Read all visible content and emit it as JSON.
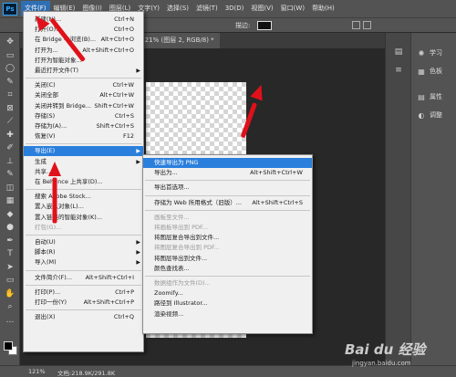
{
  "menubar": {
    "items": [
      "文件(F)",
      "编辑(E)",
      "图像(I)",
      "图层(L)",
      "文字(Y)",
      "选择(S)",
      "滤镜(T)",
      "3D(D)",
      "视图(V)",
      "窗口(W)",
      "帮助(H)"
    ],
    "logo": "Ps"
  },
  "optbar": {
    "label": "描边:"
  },
  "tab": {
    "title": "@ 121% (图层 2, RGB/8) *"
  },
  "status": {
    "zoom": "121%",
    "doc": "文档:218.9K/291.8K"
  },
  "file_menu": [
    {
      "label": "新建(N)...",
      "key": "Ctrl+N"
    },
    {
      "label": "打开(O)...",
      "key": "Ctrl+O"
    },
    {
      "label": "在 Bridge 中浏览(B)...",
      "key": "Alt+Ctrl+O"
    },
    {
      "label": "打开为...",
      "key": "Alt+Shift+Ctrl+O"
    },
    {
      "label": "打开为智能对象...",
      "key": ""
    },
    {
      "label": "最近打开文件(T)",
      "key": "",
      "sub": true
    },
    {
      "sep": true
    },
    {
      "label": "关闭(C)",
      "key": "Ctrl+W"
    },
    {
      "label": "关闭全部",
      "key": "Alt+Ctrl+W"
    },
    {
      "label": "关闭并转到 Bridge...",
      "key": "Shift+Ctrl+W"
    },
    {
      "label": "存储(S)",
      "key": "Ctrl+S"
    },
    {
      "label": "存储为(A)...",
      "key": "Shift+Ctrl+S"
    },
    {
      "label": "恢复(V)",
      "key": "F12"
    },
    {
      "sep": true
    },
    {
      "label": "导出(E)",
      "key": "",
      "sub": true,
      "hl": true
    },
    {
      "label": "生成",
      "key": "",
      "sub": true
    },
    {
      "label": "共享...",
      "key": ""
    },
    {
      "label": "在 Behance 上共享(D)...",
      "key": ""
    },
    {
      "sep": true
    },
    {
      "label": "搜索 Adobe Stock...",
      "key": ""
    },
    {
      "label": "置入嵌入对象(L)...",
      "key": ""
    },
    {
      "label": "置入链接的智能对象(K)...",
      "key": ""
    },
    {
      "label": "打包(G)...",
      "key": "",
      "dis": true
    },
    {
      "sep": true
    },
    {
      "label": "自动(U)",
      "key": "",
      "sub": true
    },
    {
      "label": "脚本(R)",
      "key": "",
      "sub": true
    },
    {
      "label": "导入(M)",
      "key": "",
      "sub": true
    },
    {
      "sep": true
    },
    {
      "label": "文件简介(F)...",
      "key": "Alt+Shift+Ctrl+I"
    },
    {
      "sep": true
    },
    {
      "label": "打印(P)...",
      "key": "Ctrl+P"
    },
    {
      "label": "打印一份(Y)",
      "key": "Alt+Shift+Ctrl+P"
    },
    {
      "sep": true
    },
    {
      "label": "退出(X)",
      "key": "Ctrl+Q"
    }
  ],
  "export_menu": [
    {
      "label": "快速导出为 PNG",
      "key": "",
      "hl": true
    },
    {
      "label": "导出为...",
      "key": "Alt+Shift+Ctrl+W"
    },
    {
      "sep": true
    },
    {
      "label": "导出首选项...",
      "key": ""
    },
    {
      "sep": true
    },
    {
      "label": "存储为 Web 所用格式（旧版）...",
      "key": "Alt+Shift+Ctrl+S"
    },
    {
      "sep": true
    },
    {
      "label": "画板至文件...",
      "key": "",
      "dis": true
    },
    {
      "label": "将画板导出到 PDF...",
      "key": "",
      "dis": true
    },
    {
      "label": "将图层复合导出到文件...",
      "key": ""
    },
    {
      "label": "将图层复合导出到 PDF...",
      "key": "",
      "dis": true
    },
    {
      "label": "将图层导出到文件...",
      "key": ""
    },
    {
      "label": "颜色查找表...",
      "key": ""
    },
    {
      "sep": true
    },
    {
      "label": "数据组作为文件(D)...",
      "key": "",
      "dis": true
    },
    {
      "label": "Zoomify...",
      "key": ""
    },
    {
      "label": "路径到 Illustrator...",
      "key": ""
    },
    {
      "label": "渲染视频...",
      "key": ""
    }
  ],
  "right_panel": {
    "items": [
      {
        "icon": "bulb-icon",
        "label": "学习"
      },
      {
        "icon": "swatches-icon",
        "label": "色板"
      },
      {
        "icon": "properties-icon",
        "label": "属性"
      },
      {
        "icon": "adjust-icon",
        "label": "调整"
      }
    ]
  },
  "watermark": {
    "brand": "Bai du 经验",
    "url": "jingyan.baidu.com"
  },
  "colors": {
    "ui": "#535353",
    "highlight": "#2a7fdc",
    "arrow": "#e0111a"
  }
}
